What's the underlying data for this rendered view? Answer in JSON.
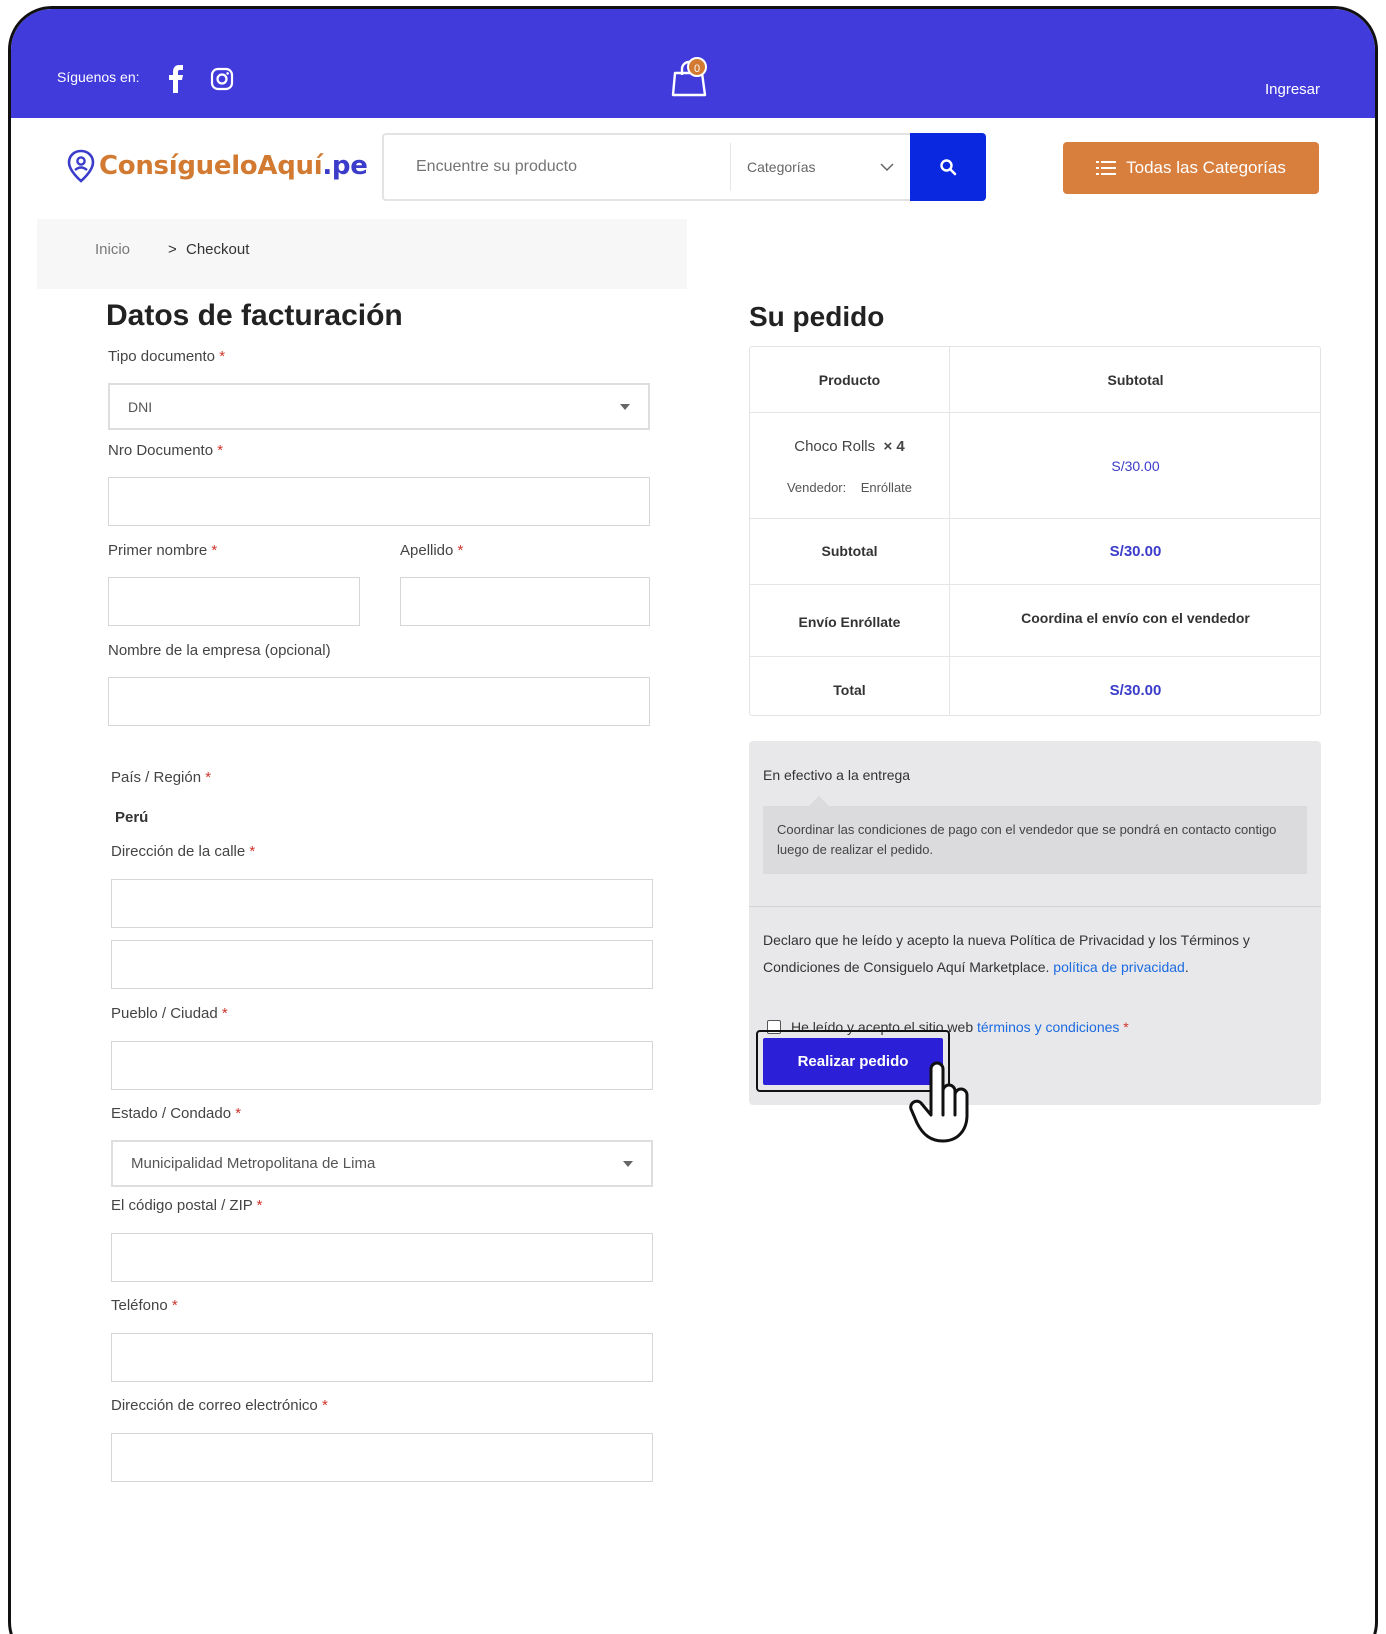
{
  "topbar": {
    "follow_label": "Síguenos en:",
    "social": [
      "facebook-icon",
      "instagram-icon"
    ],
    "cart_count": "0",
    "login": "Ingresar"
  },
  "header": {
    "logo_main": "ConsígueloAquí",
    "logo_suffix": ".pe",
    "search_placeholder": "Encuentre su producto",
    "category_select": "Categorías",
    "all_categories": "Todas las Categorías"
  },
  "breadcrumb": {
    "home": "Inicio",
    "separator": ">",
    "current": "Checkout"
  },
  "billing": {
    "title": "Datos de facturación",
    "doc_type_label": "Tipo documento",
    "doc_type_value": "DNI",
    "doc_number_label": "Nro Documento",
    "first_name_label": "Primer nombre",
    "last_name_label": "Apellido",
    "company_label": "Nombre de la empresa (opcional)",
    "country_label": "País / Región",
    "country_value": "Perú",
    "street_label": "Dirección de la calle",
    "city_label": "Pueblo / Ciudad",
    "state_label": "Estado / Condado",
    "state_value": "Municipalidad Metropolitana de Lima",
    "zip_label": "El código postal / ZIP",
    "phone_label": "Teléfono",
    "email_label": "Dirección de correo electrónico",
    "required_mark": "*"
  },
  "order": {
    "title": "Su pedido",
    "col_product": "Producto",
    "col_subtotal": "Subtotal",
    "item_name": "Choco Rolls",
    "item_qty": "× 4",
    "vendor_label": "Vendedor:",
    "vendor_name": "Enróllate",
    "item_price": "S/30.00",
    "subtotal_label": "Subtotal",
    "subtotal_value": "S/30.00",
    "shipping_label": "Envío Enróllate",
    "shipping_value": "Coordina el envío con el vendedor",
    "total_label": "Total",
    "total_value": "S/30.00"
  },
  "payment": {
    "method": "En efectivo a la entrega",
    "description": "Coordinar las condiciones de pago con el vendedor que se pondrá en contacto contigo luego de realizar el pedido.",
    "privacy_text": "Declaro que he leído y acepto la nueva Política de Privacidad y los Términos y Condiciones de Consiguelo Aquí Marketplace.",
    "privacy_link": "política de privacidad",
    "terms_text": "He leído y acepto el sitio web",
    "terms_link": "términos y condiciones",
    "place_order": "Realizar pedido"
  },
  "colors": {
    "brand_blue": "#423bdc",
    "brand_orange": "#d87f3e",
    "button_blue": "#2c1fd8"
  }
}
